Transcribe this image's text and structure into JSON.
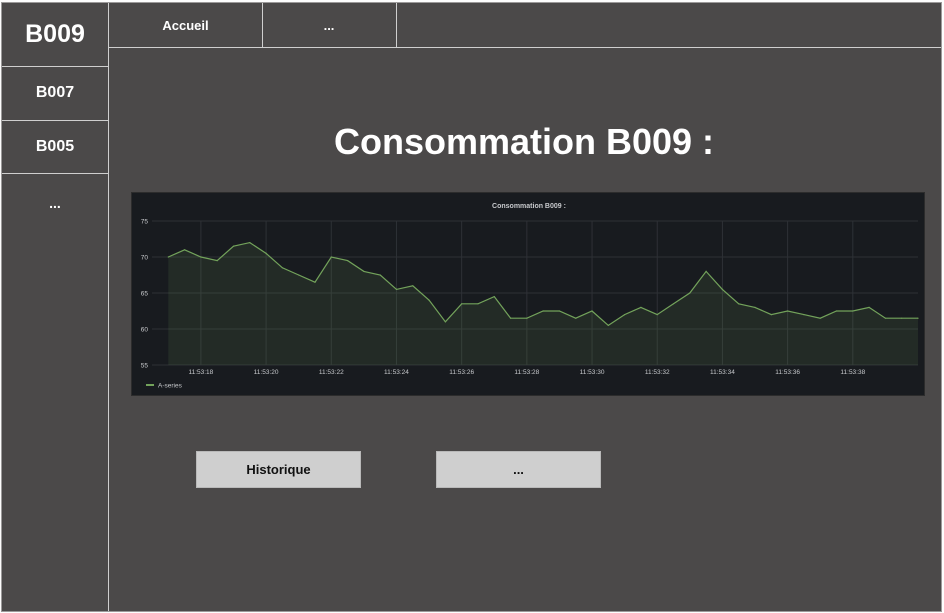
{
  "sidebar": {
    "items": [
      {
        "label": "B009"
      },
      {
        "label": "B007"
      },
      {
        "label": "B005"
      },
      {
        "label": "..."
      }
    ]
  },
  "tabs": [
    {
      "label": "Accueil"
    },
    {
      "label": "..."
    }
  ],
  "main": {
    "title": "Consommation B009 :",
    "buttons": [
      {
        "label": "Historique"
      },
      {
        "label": "..."
      }
    ]
  },
  "colors": {
    "background": "#4b4949",
    "panel_bg": "#181b1f",
    "series_line": "#73a35b",
    "button_bg": "#cfcfcf"
  },
  "chart_data": {
    "type": "area",
    "title": "Consommation B009 :",
    "xlabel": "",
    "ylabel": "",
    "x_ticks": [
      "11:53:18",
      "11:53:20",
      "11:53:22",
      "11:53:24",
      "11:53:26",
      "11:53:28",
      "11:53:30",
      "11:53:32",
      "11:53:34",
      "11:53:36",
      "11:53:38"
    ],
    "ylim": [
      55,
      75
    ],
    "y_ticks": [
      55,
      60,
      65,
      70,
      75
    ],
    "grid": true,
    "legend_position": "bottom-left",
    "series": [
      {
        "name": "A-series",
        "x": [
          17,
          17.5,
          18,
          18.5,
          19,
          19.5,
          20,
          20.5,
          21,
          21.5,
          22,
          22.5,
          23,
          23.5,
          24,
          24.5,
          25,
          25.5,
          26,
          26.5,
          27,
          27.5,
          28,
          28.5,
          29,
          29.5,
          30,
          30.5,
          31,
          31.5,
          32,
          32.5,
          33,
          33.5,
          34,
          34.5,
          35,
          35.5,
          36,
          36.5,
          37,
          37.5,
          38,
          38.5,
          39,
          39.5,
          40
        ],
        "values": [
          70,
          71,
          70,
          69.5,
          71.5,
          72,
          70.5,
          68.5,
          67.5,
          66.5,
          70,
          69.5,
          68,
          67.5,
          65.5,
          66,
          64,
          61,
          63.5,
          63.5,
          64.5,
          61.5,
          61.5,
          62.5,
          62.5,
          61.5,
          62.5,
          60.5,
          62,
          63,
          62,
          63.5,
          65,
          68,
          65.5,
          63.5,
          63,
          62,
          62.5,
          62,
          61.5,
          62.5,
          62.5,
          63,
          61.5,
          61.5,
          61.5
        ]
      }
    ]
  }
}
